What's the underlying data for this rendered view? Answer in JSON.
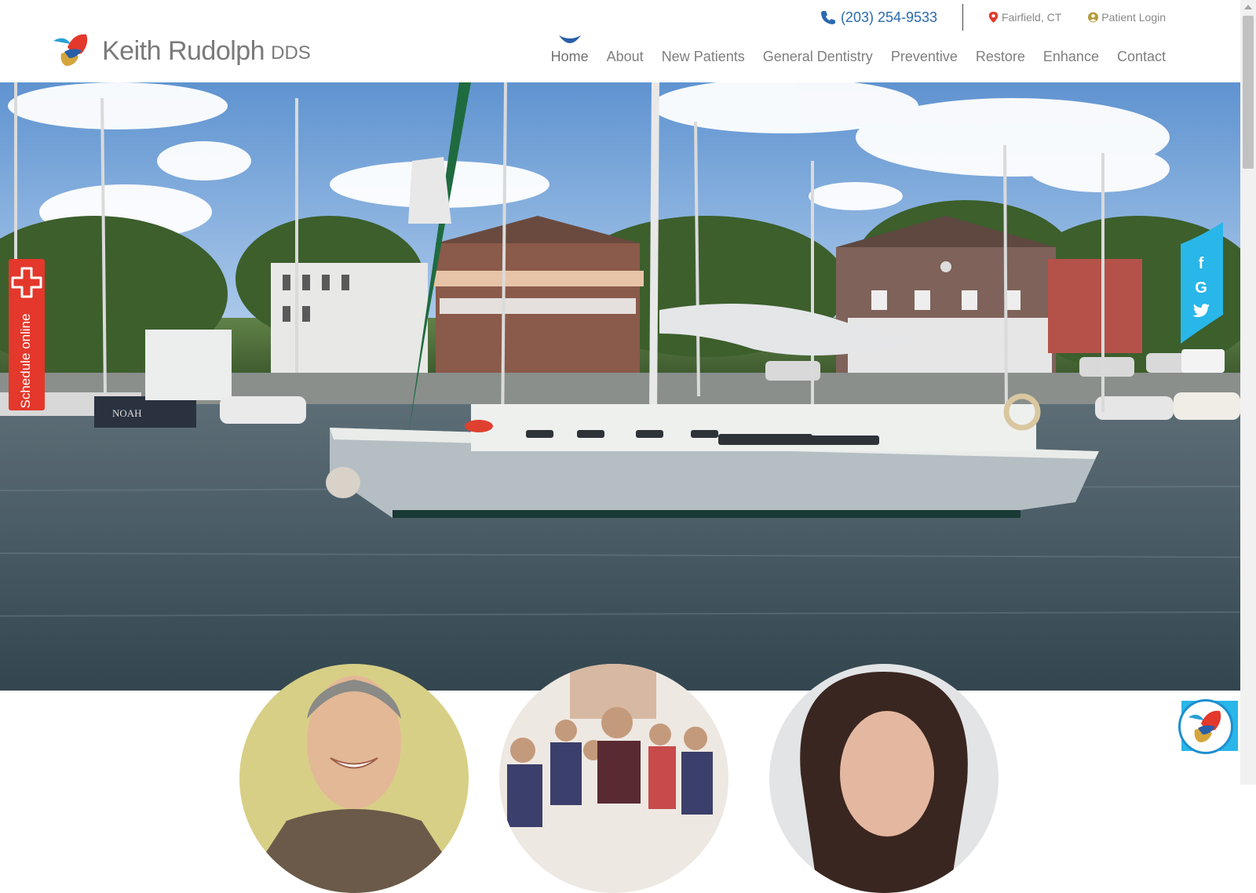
{
  "brand": {
    "name": "Keith Rudolph",
    "suffix": "DDS"
  },
  "topbar": {
    "phone": "(203) 254-9533",
    "location": "Fairfield, CT",
    "login": "Patient Login"
  },
  "nav": {
    "items": [
      {
        "label": "Home",
        "active": true
      },
      {
        "label": "About"
      },
      {
        "label": "New Patients"
      },
      {
        "label": "General Dentistry"
      },
      {
        "label": "Preventive"
      },
      {
        "label": "Restore"
      },
      {
        "label": "Enhance"
      },
      {
        "label": "Contact"
      }
    ]
  },
  "hero": {
    "boat_name": "NOAH"
  },
  "schedule": {
    "label": "Schedule online"
  },
  "social": {
    "icons": [
      "facebook-icon",
      "google-icon",
      "twitter-icon"
    ]
  },
  "colors": {
    "accent_blue": "#2a69b0",
    "schedule_red": "#e3382b",
    "social_cyan": "#29b6e8",
    "nav_text": "#7f7f7f"
  }
}
